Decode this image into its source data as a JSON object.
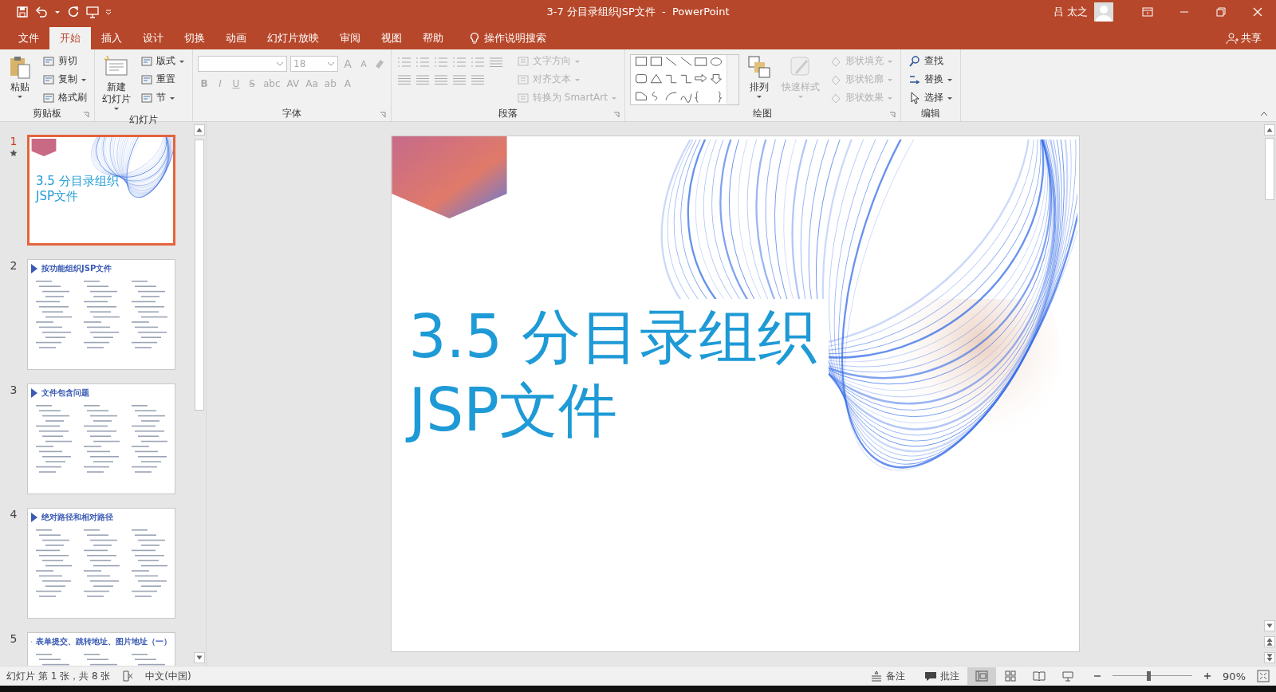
{
  "window": {
    "title": "3-7 分目录组织JSP文件  -  PowerPoint",
    "user": "吕 太之"
  },
  "ribbon_tabs": [
    {
      "label": "文件",
      "selected": false
    },
    {
      "label": "开始",
      "selected": true
    },
    {
      "label": "插入",
      "selected": false
    },
    {
      "label": "设计",
      "selected": false
    },
    {
      "label": "切换",
      "selected": false
    },
    {
      "label": "动画",
      "selected": false
    },
    {
      "label": "幻灯片放映",
      "selected": false
    },
    {
      "label": "审阅",
      "selected": false
    },
    {
      "label": "视图",
      "selected": false
    },
    {
      "label": "帮助",
      "selected": false
    }
  ],
  "tell_me": "操作说明搜索",
  "share": "共享",
  "ribbon_groups": [
    {
      "kind": "buttons",
      "label": "剪贴板",
      "large": {
        "label_lines": [
          "粘贴"
        ],
        "dropdown": true,
        "disabled": false
      },
      "small": [
        {
          "label": "剪切",
          "dropdown": false,
          "disabled": false
        },
        {
          "label": "复制",
          "dropdown": true,
          "disabled": false
        },
        {
          "label": "格式刷",
          "dropdown": false,
          "disabled": false
        }
      ]
    },
    {
      "kind": "buttons",
      "label": "幻灯片",
      "large": {
        "label_lines": [
          "新建",
          "幻灯片"
        ],
        "dropdown": true,
        "disabled": false
      },
      "small": [
        {
          "label": "版式",
          "dropdown": true,
          "disabled": false
        },
        {
          "label": "重置",
          "dropdown": false,
          "disabled": false
        },
        {
          "label": "节",
          "dropdown": true,
          "disabled": false
        }
      ]
    },
    {
      "kind": "font",
      "label": "字体",
      "font_size": "18",
      "size_buttons": [
        "A",
        "A"
      ],
      "format_buttons": [
        "B",
        "I",
        "U",
        "S",
        "abc",
        "AV",
        "Aa",
        "ab",
        "A"
      ],
      "disabled": true
    },
    {
      "kind": "paragraph",
      "label": "段落",
      "small": [
        {
          "label": "文字方向",
          "dropdown": true,
          "disabled": true
        },
        {
          "label": "对齐文本",
          "dropdown": true,
          "disabled": true
        },
        {
          "label": "转换为 SmartArt",
          "dropdown": true,
          "disabled": true
        }
      ]
    },
    {
      "kind": "drawing",
      "label": "绘图",
      "large": [
        {
          "label": "排列",
          "dropdown": true,
          "disabled": false
        },
        {
          "label": "快速样式",
          "dropdown": true,
          "disabled": true
        }
      ],
      "small": [
        {
          "label": "形状填充",
          "dropdown": true,
          "disabled": true
        },
        {
          "label": "形状轮廓",
          "dropdown": true,
          "disabled": true
        },
        {
          "label": "形状效果",
          "dropdown": true,
          "disabled": true
        }
      ]
    },
    {
      "kind": "editing",
      "label": "编辑",
      "small": [
        {
          "label": "查找",
          "dropdown": false,
          "disabled": false
        },
        {
          "label": "替换",
          "dropdown": true,
          "disabled": false
        },
        {
          "label": "选择",
          "dropdown": true,
          "disabled": false
        }
      ]
    }
  ],
  "slides": [
    {
      "number": "1",
      "kind": "title",
      "selected": true,
      "animated": true,
      "title_lines": [
        "3.5 分目录组织",
        "JSP文件"
      ]
    },
    {
      "number": "2",
      "kind": "content",
      "selected": false,
      "animated": false,
      "title_lines": [
        "按功能组织JSP文件"
      ]
    },
    {
      "number": "3",
      "kind": "content",
      "selected": false,
      "animated": false,
      "title_lines": [
        "文件包含问题"
      ]
    },
    {
      "number": "4",
      "kind": "content",
      "selected": false,
      "animated": false,
      "title_lines": [
        "绝对路径和相对路径"
      ]
    },
    {
      "number": "5",
      "kind": "content",
      "selected": false,
      "animated": false,
      "title_lines": [
        "表单提交、跳转地址、图片地址（一）"
      ]
    }
  ],
  "current_slide": {
    "title_lines": [
      "3.5 分目录组织",
      "JSP文件"
    ]
  },
  "status_bar": {
    "slide_info": "幻灯片 第 1 张，共 8 张",
    "language": "中文(中国)",
    "notes": "备注",
    "comments": "批注",
    "views": [
      {
        "selected": true
      },
      {
        "selected": false
      },
      {
        "selected": false
      },
      {
        "selected": false
      }
    ],
    "zoom": {
      "level": 0.45,
      "reading": "90%"
    }
  }
}
